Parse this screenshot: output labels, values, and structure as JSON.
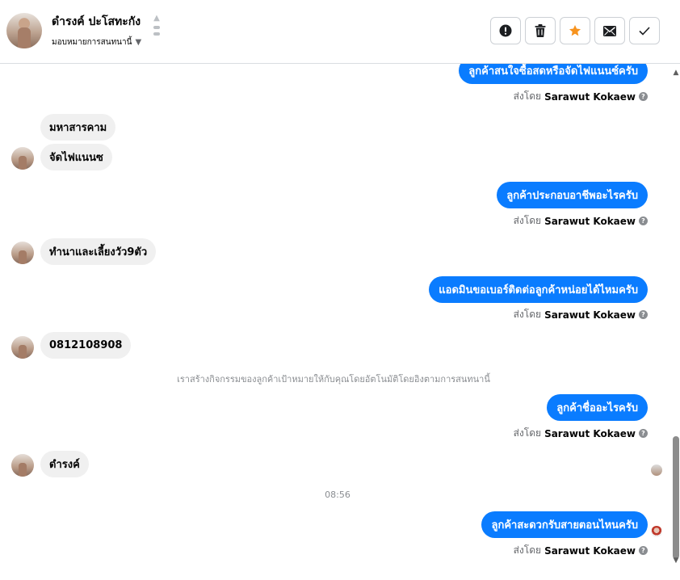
{
  "header": {
    "contact_name": "ดำรงค์ ปะโสทะกัง",
    "assign_label": "มอบหมายการสนทนานี้",
    "actions": [
      {
        "name": "mark-spam-button",
        "icon": "alert-circle-icon"
      },
      {
        "name": "delete-button",
        "icon": "trash-icon"
      },
      {
        "name": "star-button",
        "icon": "star-icon",
        "color": "#f7931e"
      },
      {
        "name": "mark-unread-button",
        "icon": "envelope-icon"
      },
      {
        "name": "mark-done-button",
        "icon": "check-icon"
      }
    ]
  },
  "colors": {
    "outgoing_bubble": "#0a7cff",
    "incoming_bubble": "#f0f0f0",
    "star": "#f7931e"
  },
  "messages": {
    "m1": {
      "text": "ลูกค้าสนใจซื้อสดหรือจัดไฟแนนซ์ครับ",
      "sent_by_prefix": "ส่งโดย",
      "sender": "Sarawut Kokaew"
    },
    "m2": {
      "text": "มหาสารคาม"
    },
    "m3": {
      "text": "จัดไฟแนนซ"
    },
    "m4": {
      "text": "ลูกค้าประกอบอาชีพอะไรครับ",
      "sent_by_prefix": "ส่งโดย",
      "sender": "Sarawut Kokaew"
    },
    "m5": {
      "text": "ทำนาและเลี้ยงวัว9ตัว"
    },
    "m6": {
      "text": "แอดมินขอเบอร์ติดต่อลูกค้าหน่อยได้ไหมครับ",
      "sent_by_prefix": "ส่งโดย",
      "sender": "Sarawut Kokaew"
    },
    "m7": {
      "text": "0812108908"
    },
    "system_note": "เราสร้างกิจกรรมของลูกค้าเป้าหมายให้กับคุณโดยอัตโนมัติโดยอิงตามการสนทนานี้",
    "m8": {
      "text": "ลูกค้าชื่ออะไรครับ",
      "sent_by_prefix": "ส่งโดย",
      "sender": "Sarawut Kokaew"
    },
    "m9": {
      "text": "ดำรงค์"
    },
    "timestamp": "08:56",
    "m10": {
      "text": "ลูกค้าสะดวกรับสายตอนไหนครับ",
      "sent_by_prefix": "ส่งโดย",
      "sender": "Sarawut Kokaew"
    }
  }
}
